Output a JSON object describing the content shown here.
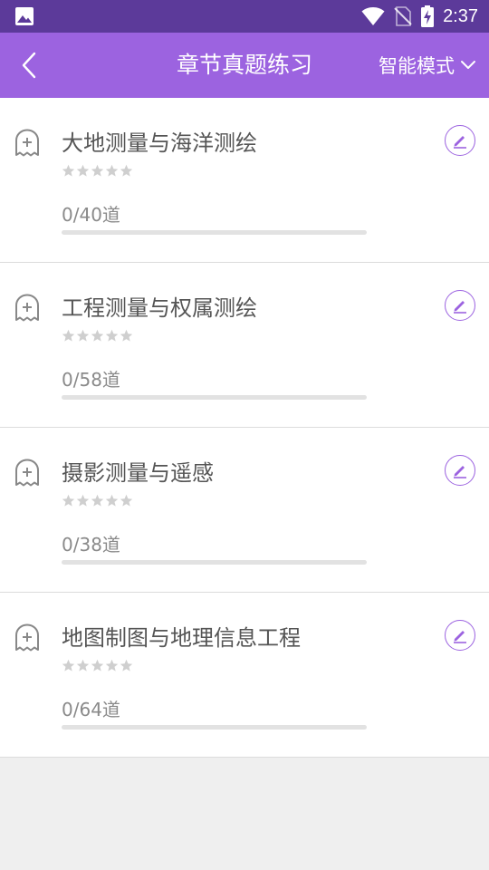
{
  "status_bar": {
    "time": "2:37",
    "icons": [
      "image-icon",
      "wifi-icon",
      "no-sim-icon",
      "battery-charging-icon"
    ]
  },
  "app_bar": {
    "title": "章节真题练习",
    "mode_label": "智能模式",
    "icons": [
      "back-icon",
      "chevron-down-icon"
    ]
  },
  "colors": {
    "status_bar": "#5c3a9a",
    "accent": "#9c63e0",
    "star_empty": "#cfcfcf",
    "progress_track": "#e2e2e2"
  },
  "chapters": [
    {
      "title": "大地测量与海洋测绘",
      "count": "0/40道",
      "stars": 0,
      "progress": 0
    },
    {
      "title": "工程测量与权属测绘",
      "count": "0/58道",
      "stars": 0,
      "progress": 0
    },
    {
      "title": "摄影测量与遥感",
      "count": "0/38道",
      "stars": 0,
      "progress": 0
    },
    {
      "title": "地图制图与地理信息工程",
      "count": "0/64道",
      "stars": 0,
      "progress": 0
    }
  ]
}
